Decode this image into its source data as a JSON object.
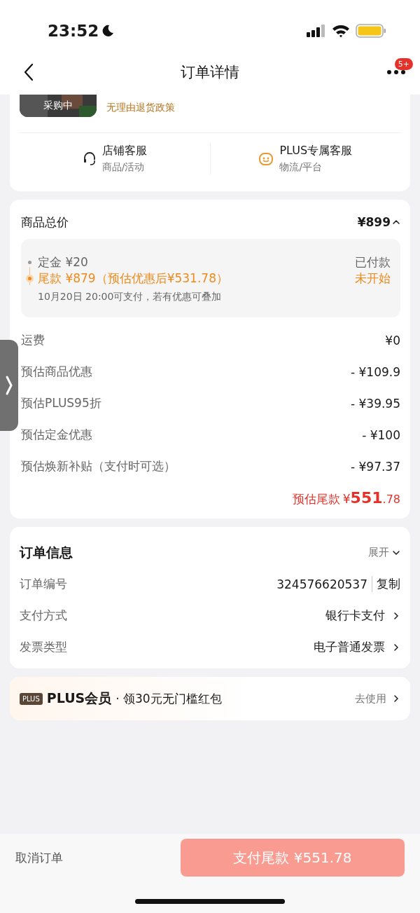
{
  "status_bar": {
    "time": "23:52"
  },
  "nav": {
    "title": "订单详情",
    "badge": "5+"
  },
  "product": {
    "thumbnail_label": "采购中",
    "policy": "无理由退货政策"
  },
  "services": [
    {
      "title": "店铺客服",
      "subtitle": "商品/活动",
      "kind": "headset"
    },
    {
      "title": "PLUS专属客服",
      "subtitle": "物流/平台",
      "kind": "smile"
    }
  ],
  "price": {
    "label": "商品总价",
    "total": "¥899",
    "expanded": true,
    "stages": [
      {
        "label": "定金 ¥20",
        "status": "已付款",
        "active": false
      },
      {
        "label": "尾款 ¥879（预估优惠后¥531.78）",
        "status": "未开始",
        "active": true,
        "note": "10月20日 20:00可支付，若有优惠可叠加"
      }
    ],
    "rows": [
      {
        "label": "运费",
        "value": "¥0"
      },
      {
        "label": "预估商品优惠",
        "value": "- ¥109.9"
      },
      {
        "label": "预估PLUS95折",
        "value": "- ¥39.95"
      },
      {
        "label": "预估定金优惠",
        "value": "- ¥100"
      },
      {
        "label": "预估焕新补贴（支付时可选）",
        "value": "- ¥97.37"
      }
    ],
    "final": {
      "label": "预估尾款",
      "currency": "¥",
      "integer": "551",
      "decimal": ".78"
    }
  },
  "order_info": {
    "title": "订单信息",
    "toggle": "展开",
    "expanded": false,
    "rows": [
      {
        "label": "订单编号",
        "value": "324576620537",
        "kind": "copy",
        "action": "复制"
      },
      {
        "label": "支付方式",
        "value": "银行卡支付",
        "kind": "link"
      },
      {
        "label": "发票类型",
        "value": "电子普通发票",
        "kind": "link"
      }
    ]
  },
  "plus_banner": {
    "badge": "PLUS",
    "title": "PLUS会员",
    "text": "· 领30元无门槛红包",
    "action": "去使用"
  },
  "footer": {
    "cancel": "取消订单",
    "pay": "支付尾款 ¥551.78"
  }
}
